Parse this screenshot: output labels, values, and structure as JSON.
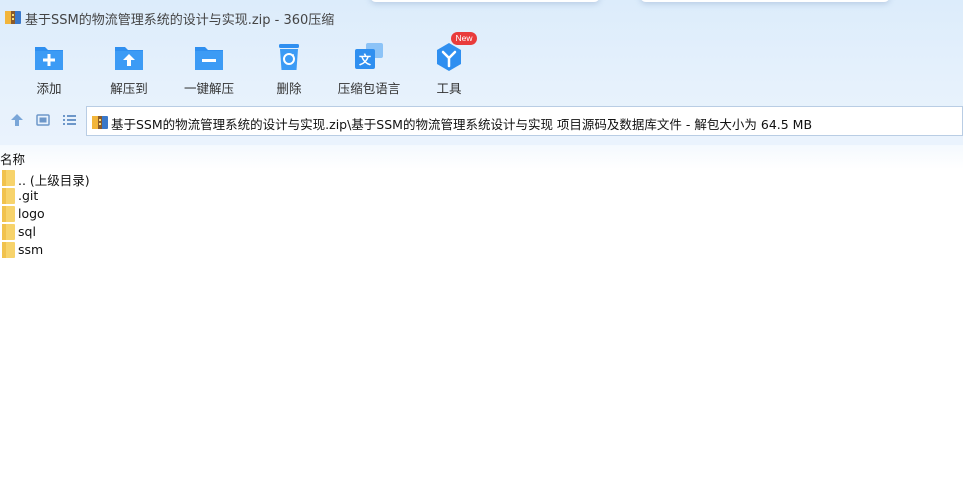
{
  "window": {
    "title": "基于SSM的物流管理系统的设计与实现.zip - 360压缩"
  },
  "toolbar": {
    "items": [
      {
        "label": "添加",
        "icon": "add-icon"
      },
      {
        "label": "解压到",
        "icon": "extract-to-icon"
      },
      {
        "label": "一键解压",
        "icon": "one-click-extract-icon"
      },
      {
        "label": "删除",
        "icon": "delete-icon"
      },
      {
        "label": "压缩包语言",
        "icon": "archive-language-icon"
      },
      {
        "label": "工具",
        "icon": "tools-icon"
      }
    ],
    "new_badge": "New"
  },
  "address": {
    "path": "基于SSM的物流管理系统的设计与实现.zip\\基于SSM的物流管理系统设计与实现 项目源码及数据库文件 - 解包大小为 64.5 MB"
  },
  "file_list": {
    "column_name": "名称",
    "rows": [
      {
        "name": ".. (上级目录)"
      },
      {
        "name": ".git"
      },
      {
        "name": "logo"
      },
      {
        "name": "sql"
      },
      {
        "name": "ssm"
      }
    ]
  },
  "colors": {
    "accent": "#2f8ff0",
    "folder": "#f7d36b",
    "badge": "#e93b3b"
  }
}
